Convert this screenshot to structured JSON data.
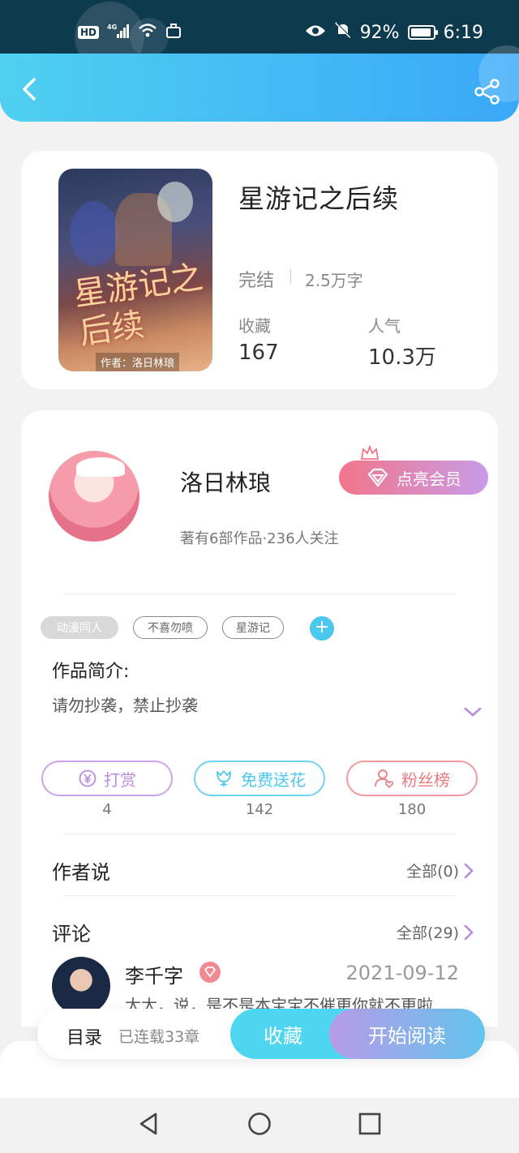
{
  "status_bar": {
    "hd": "HD",
    "network": "4G",
    "battery": "92%",
    "time": "6:19"
  },
  "header": {
    "back_icon": "chevron-left-icon",
    "share_icon": "share-icon"
  },
  "book": {
    "title": "星游记之后续",
    "cover_title": "星游记之后续",
    "cover_author": "作者：洛日林琅",
    "status": "完结",
    "words": "2.5万字",
    "favorites_label": "收藏",
    "favorites_value": "167",
    "popularity_label": "人气",
    "popularity_value": "10.3万"
  },
  "author": {
    "name": "洛日林琅",
    "meta": "著有6部作品·236人关注",
    "vip_label": "点亮会员"
  },
  "tags": [
    "动漫同人",
    "不喜勿喷",
    "星游记"
  ],
  "intro": {
    "label": "作品简介:",
    "text": "请勿抄袭，禁止抄袭"
  },
  "actions": [
    {
      "label": "打赏",
      "count": "4",
      "color": "#b98be0",
      "icon": "yuan-coin-icon"
    },
    {
      "label": "免费送花",
      "count": "142",
      "color": "#4cc7ee",
      "icon": "flower-icon"
    },
    {
      "label": "粉丝榜",
      "count": "180",
      "color": "#ec7b80",
      "icon": "fan-user-icon"
    }
  ],
  "author_says": {
    "title": "作者说",
    "link": "全部(0)"
  },
  "comments": {
    "title": "评论",
    "link": "全部(29)",
    "first": {
      "user": "李千字",
      "date": "2021-09-12",
      "text": "太太，说，是不是本宝宝不催更你就不更啦"
    }
  },
  "bottom_bar": {
    "toc": "目录",
    "chapters": "已连载33章",
    "collect": "收藏",
    "read": "开始阅读"
  },
  "colors": {
    "header_start": "#4fd0f0",
    "header_end": "#3aa8f8",
    "accent_blue": "#4cc7ee",
    "accent_pink": "#f2758a",
    "accent_purple": "#b98be0"
  }
}
